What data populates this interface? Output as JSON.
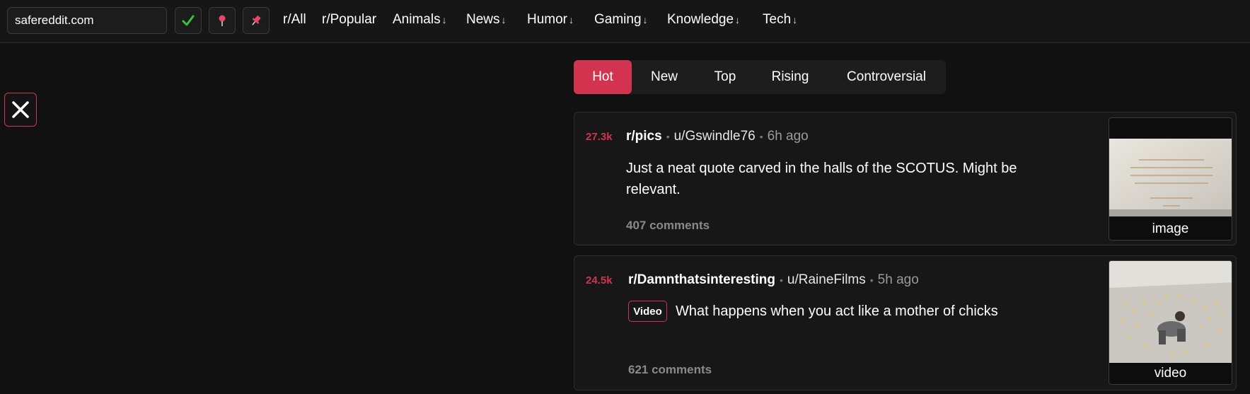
{
  "header": {
    "domain_value": "safereddit.com",
    "nav": [
      {
        "label": "r/All",
        "dropdown": false
      },
      {
        "label": "r/Popular",
        "dropdown": false
      },
      {
        "label": "Animals",
        "dropdown": true
      },
      {
        "label": "News",
        "dropdown": true
      },
      {
        "label": "Humor",
        "dropdown": true
      },
      {
        "label": "Gaming",
        "dropdown": true
      },
      {
        "label": "Knowledge",
        "dropdown": true
      },
      {
        "label": "Tech",
        "dropdown": true
      }
    ],
    "dropdown_arrow": "↓",
    "icons": [
      "check-icon",
      "pin-icon",
      "pushpin-icon"
    ]
  },
  "sort": {
    "tabs": [
      "Hot",
      "New",
      "Top",
      "Rising",
      "Controversial"
    ],
    "active": "Hot"
  },
  "posts": [
    {
      "score": "27.3k",
      "subreddit": "r/pics",
      "user": "u/Gswindle76",
      "time": "6h ago",
      "title": "Just a neat quote carved in the halls of the SCOTUS. Might be relevant.",
      "comments": "407 comments",
      "thumb_caption": "image",
      "thumb_text": "IT IS EMPHATICALLY THE PROVINCE AND DUTY OF THE JUDICIAL DEPARTMENT TO SAY WHAT THE LAW IS. MARBURY v. MADISON 1803"
    },
    {
      "score": "24.5k",
      "subreddit": "r/Damnthatsinteresting",
      "user": "u/RaineFilms",
      "time": "5h ago",
      "badge": "Video",
      "title": "What happens when you act like a mother of chicks",
      "comments": "621 comments",
      "thumb_caption": "video"
    }
  ],
  "colors": {
    "accent": "#d2344f",
    "check": "#3fbf3f",
    "background": "#111111"
  }
}
